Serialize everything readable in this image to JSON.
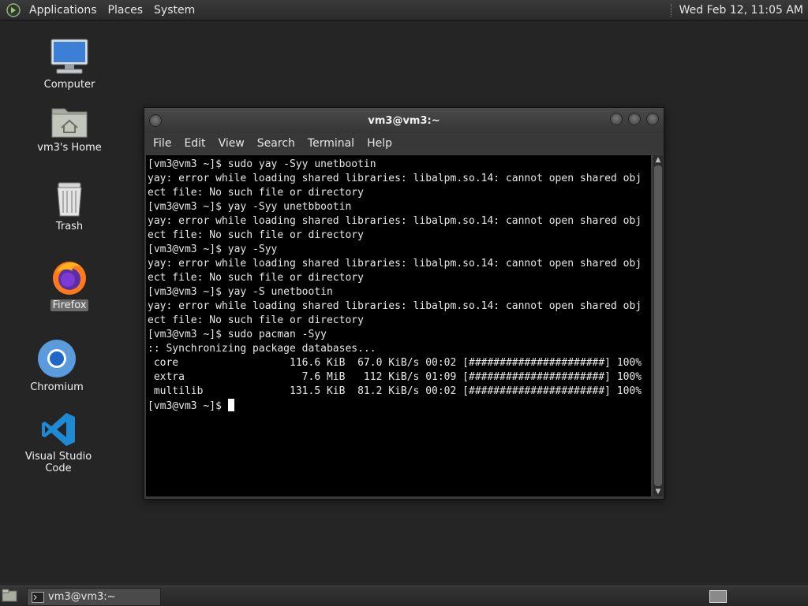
{
  "top_panel": {
    "menus": [
      "Applications",
      "Places",
      "System"
    ],
    "clock": "Wed Feb 12, 11:05 AM"
  },
  "desktop_icons": [
    {
      "label": "Computer",
      "icon": "computer-icon"
    },
    {
      "label": "vm3's Home",
      "icon": "home-folder-icon"
    },
    {
      "label": "Trash",
      "icon": "trash-icon"
    },
    {
      "label": "Firefox",
      "icon": "firefox-icon"
    },
    {
      "label": "Chromium",
      "icon": "chromium-icon"
    },
    {
      "label": "Visual Studio Code",
      "icon": "vscode-icon"
    }
  ],
  "window": {
    "title": "vm3@vm3:~",
    "menus": [
      "File",
      "Edit",
      "View",
      "Search",
      "Terminal",
      "Help"
    ]
  },
  "terminal": {
    "lines": [
      "[vm3@vm3 ~]$ sudo yay -Syy unetbootin",
      "yay: error while loading shared libraries: libalpm.so.14: cannot open shared obj",
      "ect file: No such file or directory",
      "[vm3@vm3 ~]$ yay -Syy unetbbootin",
      "yay: error while loading shared libraries: libalpm.so.14: cannot open shared obj",
      "ect file: No such file or directory",
      "[vm3@vm3 ~]$ yay -Syy",
      "yay: error while loading shared libraries: libalpm.so.14: cannot open shared obj",
      "ect file: No such file or directory",
      "[vm3@vm3 ~]$ yay -S unetbootin",
      "yay: error while loading shared libraries: libalpm.so.14: cannot open shared obj",
      "ect file: No such file or directory",
      "[vm3@vm3 ~]$ sudo pacman -Syy",
      ":: Synchronizing package databases...",
      " core                  116.6 KiB  67.0 KiB/s 00:02 [######################] 100%",
      " extra                   7.6 MiB   112 KiB/s 01:09 [######################] 100%",
      " multilib              131.5 KiB  81.2 KiB/s 00:02 [######################] 100%"
    ],
    "prompt": "[vm3@vm3 ~]$ "
  },
  "taskbar": {
    "items": [
      {
        "label": "vm3@vm3:~"
      }
    ]
  }
}
